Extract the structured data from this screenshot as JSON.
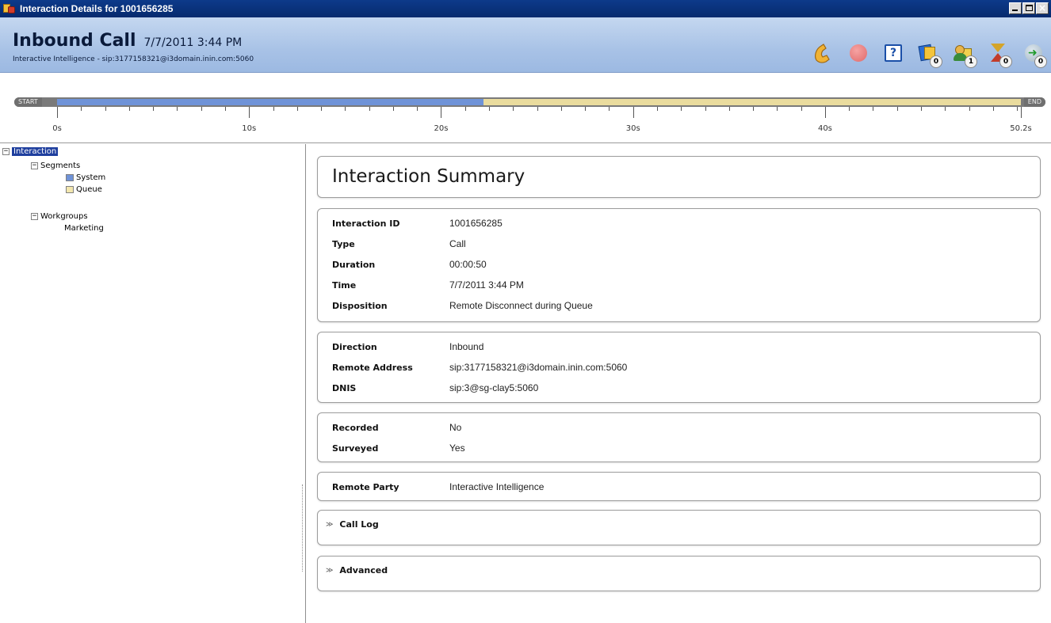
{
  "window": {
    "title": "Interaction Details for 1001656285",
    "icon": "interaction-details-icon"
  },
  "header": {
    "type": "Inbound Call",
    "datetime": "7/7/2011 3:44 PM",
    "subtitle": "Interactive Intelligence - sip:3177158321@i3domain.inin.com:5060"
  },
  "toolbar": [
    {
      "name": "phone-icon",
      "badge": ""
    },
    {
      "name": "record-icon",
      "badge": ""
    },
    {
      "name": "help-check-icon",
      "badge": ""
    },
    {
      "name": "card-icon",
      "badge": "0"
    },
    {
      "name": "users-icon",
      "badge": "1"
    },
    {
      "name": "hourglass-icon",
      "badge": "0"
    },
    {
      "name": "transfer-icon",
      "badge": "0"
    }
  ],
  "timeline": {
    "start_label": "START",
    "end_label": "END",
    "duration_seconds": 50.2,
    "tick_labels": [
      "0s",
      "10s",
      "20s",
      "30s",
      "40s",
      "50.2s"
    ],
    "tick_values": [
      0,
      10,
      20,
      30,
      40,
      50.2
    ],
    "segments": [
      {
        "name": "System",
        "start": 0,
        "end": 22.2,
        "color": "#6f93d8"
      },
      {
        "name": "Queue",
        "start": 22.2,
        "end": 50.2,
        "color": "#eadc9e"
      }
    ]
  },
  "tree": {
    "root": "Interaction",
    "segments_label": "Segments",
    "segments": [
      {
        "label": "System",
        "color": "#6f93d8"
      },
      {
        "label": "Queue",
        "color": "#f3e7ae"
      }
    ],
    "workgroups_label": "Workgroups",
    "workgroups": [
      "Marketing"
    ]
  },
  "summary": {
    "title": "Interaction Summary",
    "details": [
      {
        "label": "Interaction ID",
        "value": "1001656285"
      },
      {
        "label": "Type",
        "value": "Call"
      },
      {
        "label": "Duration",
        "value": "00:00:50"
      },
      {
        "label": "Time",
        "value": "7/7/2011 3:44 PM"
      },
      {
        "label": "Disposition",
        "value": "Remote Disconnect during Queue"
      }
    ],
    "routing": [
      {
        "label": "Direction",
        "value": "Inbound"
      },
      {
        "label": "Remote Address",
        "value": "sip:3177158321@i3domain.inin.com:5060"
      },
      {
        "label": "DNIS",
        "value": "sip:3@sg-clay5:5060"
      }
    ],
    "flags": [
      {
        "label": "Recorded",
        "value": "No"
      },
      {
        "label": "Surveyed",
        "value": "Yes"
      }
    ],
    "party": [
      {
        "label": "Remote Party",
        "value": "Interactive Intelligence"
      }
    ],
    "call_log_label": "Call Log",
    "advanced_label": "Advanced"
  }
}
